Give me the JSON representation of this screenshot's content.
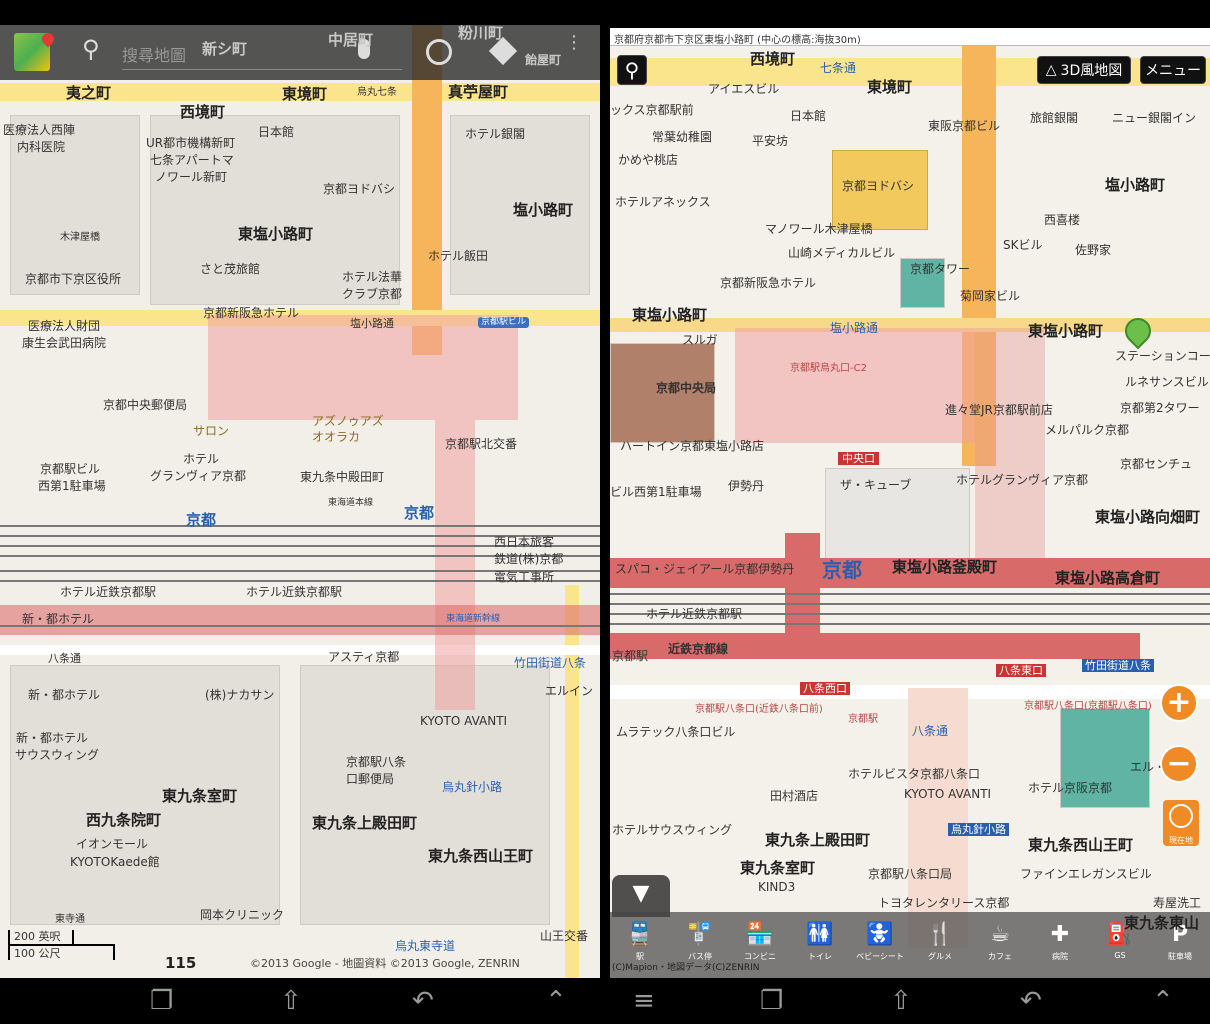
{
  "left_app": {
    "search_placeholder": "搜尋地圖",
    "icons": [
      "google-maps-logo",
      "search-icon",
      "microphone-icon",
      "my-location-icon",
      "directions-icon",
      "overflow-menu-icon"
    ],
    "labels": [
      "夷之町",
      "西境町",
      "東境町",
      "烏丸七条",
      "真苧屋町",
      "中居町",
      "粉川町",
      "飴屋町",
      "新シ町",
      "医療法人西陣",
      "内科医院",
      "UR都市機構新町",
      "七条アパートマ",
      "ノワール新町",
      "日本館",
      "ホテル銀閣",
      "京都ヨドバシ",
      "塩小路町",
      "東塩小路町",
      "木津屋橋",
      "さと茂旅館",
      "ホテル法華",
      "クラブ京都",
      "ホテル飯田",
      "京都市下京区役所",
      "京都新阪急ホテル",
      "塩小路通",
      "医療法人財団",
      "康生会武田病院",
      "京都中央郵便局",
      "アズノゥアズ",
      "オオラカ",
      "サロン",
      "京都駅北交番",
      "京都駅ビル",
      "西第1駐車場",
      "ホテル",
      "グランヴィア京都",
      "京都",
      "東海道本線",
      "西日本旅客",
      "鉄道(株)京都",
      "電気工事所",
      "ホテル近鉄京都駅",
      "新・都ホテル",
      "東海道新幹線",
      "八条通",
      "アスティ京都",
      "竹田街道八条",
      "エルイン",
      "(株)ナカサン",
      "新・都ホテル",
      "サウスウィング",
      "KYOTO AVANTI",
      "京都駅八条",
      "口郵便局",
      "東九条室町",
      "烏丸針小路",
      "西九条院町",
      "東九条上殿田町",
      "イオンモール",
      "KYOTOKaede館",
      "東九条西山王町",
      "東寺通",
      "岡本クリニック",
      "山王交番",
      "烏丸東寺道",
      "東九条中殿田町",
      "京都駅ビル",
      "115"
    ],
    "scale": {
      "feet": "200 英呎",
      "meters": "100 公尺"
    },
    "copyright": "©2013 Google - 地圖資料 ©2013 Google, ZENRIN"
  },
  "right_app": {
    "address": "京都府京都市下京区東塩小路町 (中心の標高:海抜30m)",
    "btn_3d": "3D風地図",
    "btn_menu": "メニュー",
    "labels": [
      "西境町",
      "七条通",
      "東境町",
      "アイエスビル",
      "日本館",
      "ックス京都駅前",
      "常葉幼稚園",
      "平安坊",
      "かめや桃店",
      "京都ヨドバシ",
      "東阪京都ビル",
      "旅館銀閣",
      "ニュー銀閣イン",
      "塩小路町",
      "ホテルアネックス",
      "マノワール木津屋橋",
      "西喜楼",
      "山崎メディカルビル",
      "京都タワー",
      "SKビル",
      "佐野家",
      "菊岡家ビル",
      "京都新阪急ホテル",
      "東塩小路町",
      "塩小路通",
      "東塩小路町",
      "スルガ",
      "京都駅烏丸口-C2",
      "ステーションコートヤ",
      "ルネサンスビル",
      "京都中央局",
      "進々堂JR京都駅前店",
      "京都第2タワー",
      "メルパルク京都",
      "ハートイン京都東塩小路店",
      "京都センチュ",
      "中央口",
      "伊勢丹",
      "ザ・キューブ",
      "ホテルグランヴィア京都",
      "ビル西第1駐車場",
      "東塩小路向畑町",
      "京都",
      "東塩小路釜殿町",
      "東塩小路高倉町",
      "スパコ・ジェイアール京都伊勢丹",
      "ホテル近鉄京都駅",
      "近鉄京都線",
      "京都駅",
      "竹田街道八条",
      "八条東口",
      "八条西口",
      "京都駅八条口(近鉄八条口前)",
      "京都駅",
      "京都駅八条口(京都駅八条口)",
      "八条通",
      "ムラテック八条口ビル",
      "ホテルビスタ京都八条口",
      "KYOTO AVANTI",
      "ホテル京阪京都",
      "田村酒店",
      "エル・",
      "東九条上殿田町",
      "烏丸針小路",
      "東九条西山王町",
      "ホテルサウスウィング",
      "東九条室町",
      "京都駅八条口局",
      "ファインエレガンスビル",
      "KIND3",
      "トヨタレンタリース京都",
      "寿屋洗工",
      "東九条東山"
    ],
    "toolbar": [
      {
        "label": "駅",
        "icon": "train-icon"
      },
      {
        "label": "バス停",
        "icon": "bus-stop-icon"
      },
      {
        "label": "コンビニ",
        "icon": "convenience-store-icon"
      },
      {
        "label": "トイレ",
        "icon": "toilet-icon"
      },
      {
        "label": "ベビーシート",
        "icon": "baby-seat-icon"
      },
      {
        "label": "グルメ",
        "icon": "restaurant-icon"
      },
      {
        "label": "カフェ",
        "icon": "cafe-icon"
      },
      {
        "label": "病院",
        "icon": "hospital-icon"
      },
      {
        "label": "GS",
        "icon": "gas-station-icon"
      },
      {
        "label": "駐車場",
        "icon": "parking-icon"
      }
    ],
    "current_location": "現在地",
    "copyright": "(C)Mapion・地図データ(C)ZENRIN"
  },
  "colors": {
    "accent": "#f08a24",
    "station": "#e07070",
    "road_major": "#fbe58c"
  }
}
